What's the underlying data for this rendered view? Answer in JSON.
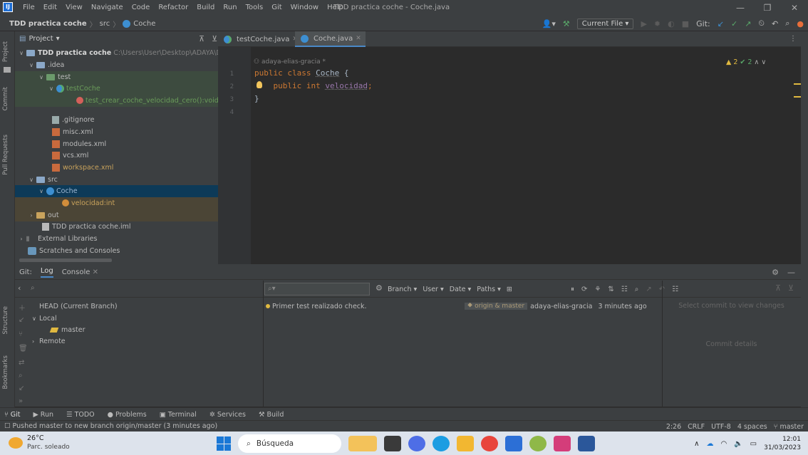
{
  "menubar": {
    "items": [
      "File",
      "Edit",
      "View",
      "Navigate",
      "Code",
      "Refactor",
      "Build",
      "Run",
      "Tools",
      "Git",
      "Window",
      "Help"
    ],
    "window_title": "TDD practica coche - Coche.java"
  },
  "navbar": {
    "project": "TDD practica coche",
    "folder": "src",
    "file": "Coche",
    "run_config": "Current File",
    "git_label": "Git:"
  },
  "left_stripe": {
    "project": "Project",
    "commit": "Commit",
    "pull_requests": "Pull Requests",
    "structure": "Structure",
    "bookmarks": "Bookmarks"
  },
  "project_panel": {
    "title": "Project",
    "tree": [
      {
        "label": "TDD practica coche",
        "suffix": "C:\\Users\\User\\Desktop\\ADAYA\\DA"
      },
      {
        "label": ".idea"
      },
      {
        "label": "test"
      },
      {
        "label": "testCoche"
      },
      {
        "label": "test_crear_coche_velocidad_cero():void"
      },
      {
        "label": ".gitignore"
      },
      {
        "label": "misc.xml"
      },
      {
        "label": "modules.xml"
      },
      {
        "label": "vcs.xml"
      },
      {
        "label": "workspace.xml"
      },
      {
        "label": "src"
      },
      {
        "label": "Coche"
      },
      {
        "label": "velocidad:int"
      },
      {
        "label": "out"
      },
      {
        "label": "TDD practica coche.iml"
      },
      {
        "label": "External Libraries"
      },
      {
        "label": "Scratches and Consoles"
      }
    ]
  },
  "editor": {
    "tabs": [
      {
        "label": "testCoche.java"
      },
      {
        "label": "Coche.java"
      }
    ],
    "author": "adaya-elias-gracia *",
    "warnings": "2",
    "checks": "2",
    "lines": {
      "n1": "1",
      "n2": "2",
      "n3": "3",
      "n4": "4",
      "l1_kw": "public class ",
      "l1_name": "Coche",
      "l1_rest": " {",
      "l2_kw": "    public int ",
      "l2_name": "velocidad",
      "l2_rest": ";",
      "l3": "}"
    }
  },
  "git_window": {
    "label": "Git:",
    "tab_log": "Log",
    "tab_console": "Console",
    "branches": {
      "head": "HEAD (Current Branch)",
      "local": "Local",
      "master": "master",
      "remote": "Remote"
    },
    "filters": [
      "Branch ▾",
      "User ▾",
      "Date ▾",
      "Paths ▾"
    ],
    "commit": {
      "message": "Primer test realizado check.",
      "refs": "origin & master",
      "author": "adaya-elias-gracia",
      "date": "3 minutes ago"
    },
    "details_select": "Select commit to view changes",
    "details_label": "Commit details"
  },
  "toolbar": {
    "items": [
      "Git",
      "Run",
      "TODO",
      "Problems",
      "Terminal",
      "Services",
      "Build"
    ]
  },
  "statusbar": {
    "message": "Pushed master to new branch origin/master (3 minutes ago)",
    "position": "2:26",
    "line_sep": "CRLF",
    "encoding": "UTF-8",
    "indent": "4 spaces",
    "branch": "master"
  },
  "taskbar": {
    "temp": "26°C",
    "condition": "Parc. soleado",
    "search": "Búsqueda",
    "time": "12:01",
    "date": "31/03/2023"
  }
}
